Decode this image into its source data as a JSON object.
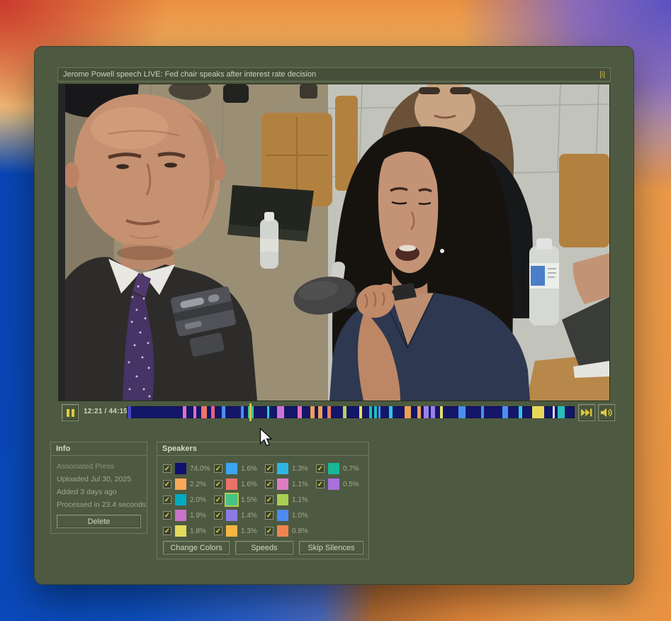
{
  "window": {
    "titlebar": {
      "title": "Jerome Powell speech LIVE: Fed chair speaks after interest rate decision",
      "info_button": "[i]"
    },
    "player": {
      "time": "12:21 / 44:15",
      "timeline": {
        "background": "#14166a",
        "playhead": {
          "pos": 0.275,
          "color": "#d8c04a"
        },
        "segments": [
          {
            "x": 0.002,
            "w": 0.008,
            "c": "#4646c2"
          },
          {
            "x": 0.125,
            "w": 0.008,
            "c": "#e070c0"
          },
          {
            "x": 0.149,
            "w": 0.006,
            "c": "#e070c0"
          },
          {
            "x": 0.166,
            "w": 0.013,
            "c": "#ee7468"
          },
          {
            "x": 0.188,
            "w": 0.008,
            "c": "#ee6078"
          },
          {
            "x": 0.212,
            "w": 0.008,
            "c": "#4a90f0"
          },
          {
            "x": 0.255,
            "w": 0.006,
            "c": "#4a90f0"
          },
          {
            "x": 0.271,
            "w": 0.013,
            "c": "#40c488"
          },
          {
            "x": 0.313,
            "w": 0.005,
            "c": "#2ad0c8"
          },
          {
            "x": 0.335,
            "w": 0.017,
            "c": "#cc74d4"
          },
          {
            "x": 0.381,
            "w": 0.01,
            "c": "#e070c0"
          },
          {
            "x": 0.41,
            "w": 0.01,
            "c": "#f0a050"
          },
          {
            "x": 0.427,
            "w": 0.01,
            "c": "#f0a050"
          },
          {
            "x": 0.448,
            "w": 0.008,
            "c": "#f08060"
          },
          {
            "x": 0.483,
            "w": 0.008,
            "c": "#b8d058"
          },
          {
            "x": 0.519,
            "w": 0.006,
            "c": "#e8e060"
          },
          {
            "x": 0.541,
            "w": 0.006,
            "c": "#20c0b0"
          },
          {
            "x": 0.552,
            "w": 0.006,
            "c": "#20c0b0"
          },
          {
            "x": 0.562,
            "w": 0.005,
            "c": "#4a90f0"
          },
          {
            "x": 0.585,
            "w": 0.008,
            "c": "#30c8e0"
          },
          {
            "x": 0.62,
            "w": 0.014,
            "c": "#f0a050"
          },
          {
            "x": 0.649,
            "w": 0.008,
            "c": "#f0a050"
          },
          {
            "x": 0.663,
            "w": 0.011,
            "c": "#9a80e8"
          },
          {
            "x": 0.679,
            "w": 0.01,
            "c": "#9a80e8"
          },
          {
            "x": 0.699,
            "w": 0.006,
            "c": "#e8e060"
          },
          {
            "x": 0.741,
            "w": 0.016,
            "c": "#4a90f0"
          },
          {
            "x": 0.791,
            "w": 0.006,
            "c": "#4a90f0"
          },
          {
            "x": 0.839,
            "w": 0.013,
            "c": "#4a90f0"
          },
          {
            "x": 0.875,
            "w": 0.008,
            "c": "#30c8e0"
          },
          {
            "x": 0.905,
            "w": 0.027,
            "c": "#e8d858"
          },
          {
            "x": 0.951,
            "w": 0.005,
            "c": "#d8d8e8"
          },
          {
            "x": 0.962,
            "w": 0.016,
            "c": "#28c0b8"
          }
        ]
      },
      "icons": {
        "pause": "pause-bars",
        "skip_forward": "double-triangle-with-bar",
        "volume": "speaker-with-waves"
      }
    },
    "info_panel": {
      "header": "Info",
      "lines": [
        "Associated Press",
        "Uploaded Jul 30, 2025",
        "Added 3 days ago",
        "Processed in 23.4 seconds"
      ],
      "delete_label": "Delete"
    },
    "speakers_panel": {
      "header": "Speakers",
      "check_glyph": "✓",
      "entries": [
        {
          "pct": "74.0%",
          "color": "#10106e",
          "checked": true
        },
        {
          "pct": "2.2%",
          "color": "#f9a85b",
          "checked": true
        },
        {
          "pct": "2.0%",
          "color": "#00a9c0",
          "checked": true
        },
        {
          "pct": "1.9%",
          "color": "#c873c8",
          "checked": true
        },
        {
          "pct": "1.8%",
          "color": "#e5d95e",
          "checked": true
        },
        {
          "pct": "1.6%",
          "color": "#3ca5f0",
          "checked": true
        },
        {
          "pct": "1.6%",
          "color": "#ea7268",
          "checked": true
        },
        {
          "pct": "1.5%",
          "color": "#48c287",
          "checked": true,
          "highlighted": true
        },
        {
          "pct": "1.4%",
          "color": "#8b7ae5",
          "checked": true
        },
        {
          "pct": "1.3%",
          "color": "#f6b541",
          "checked": true
        },
        {
          "pct": "1.3%",
          "color": "#30b4e4",
          "checked": true
        },
        {
          "pct": "1.1%",
          "color": "#df7dc4",
          "checked": true
        },
        {
          "pct": "1.1%",
          "color": "#a9cf52",
          "checked": true
        },
        {
          "pct": "1.0%",
          "color": "#4c8cf0",
          "checked": true
        },
        {
          "pct": "0.8%",
          "color": "#ef8450",
          "checked": true
        },
        {
          "pct": "0.7%",
          "color": "#19b795",
          "checked": true
        },
        {
          "pct": "0.5%",
          "color": "#a970de",
          "checked": true
        }
      ],
      "buttons": [
        "Change Colors",
        "Speeds",
        "Skip Silences"
      ]
    }
  }
}
